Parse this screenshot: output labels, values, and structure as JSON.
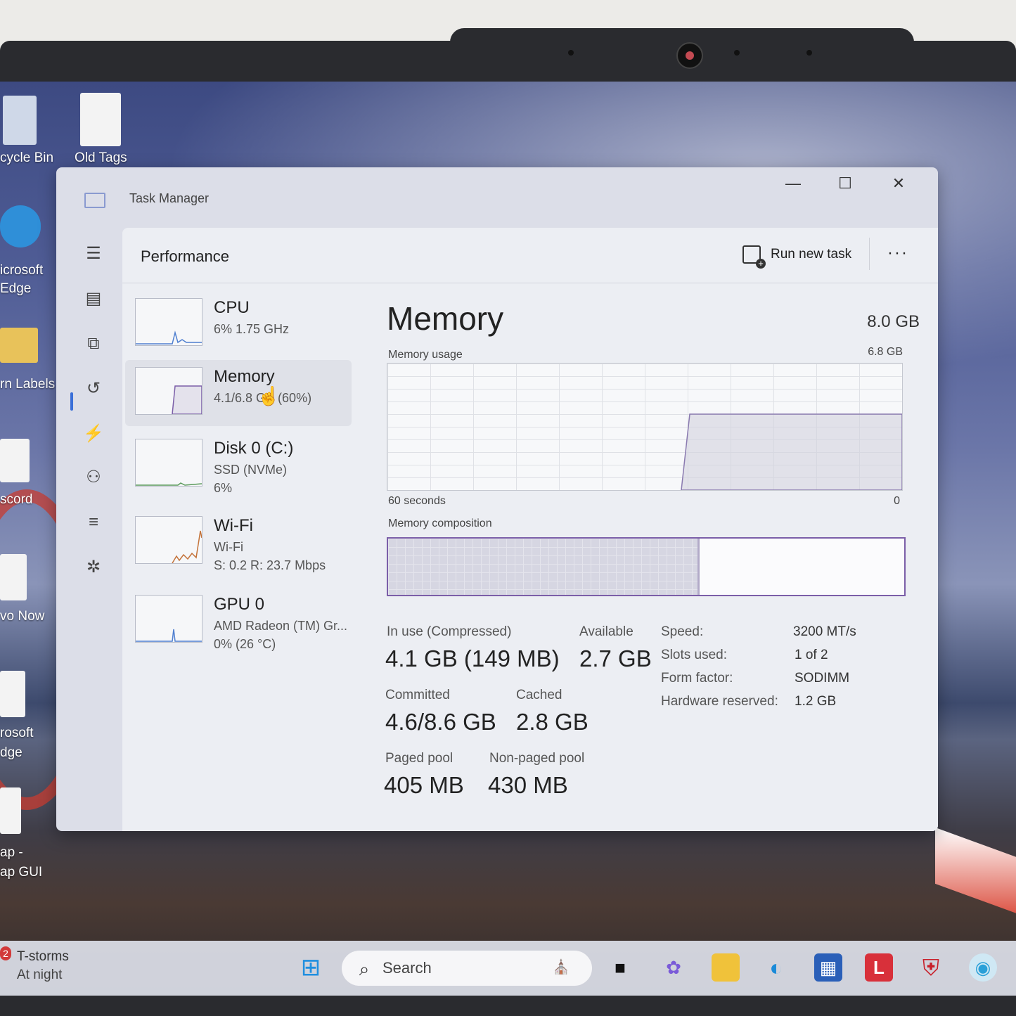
{
  "desktop": {
    "icons": [
      "cycle Bin",
      "Old Tags",
      "icrosoft",
      "Edge",
      "rn Labels",
      "scord",
      "vo Now",
      "rosoft",
      "dge",
      "ap -",
      "ap GUI"
    ]
  },
  "window": {
    "title": "Task Manager",
    "minimize": "—",
    "maximize": "☐",
    "close": "✕"
  },
  "header": {
    "page_title": "Performance",
    "run_task": "Run new task",
    "more": "···"
  },
  "devices": [
    {
      "name": "CPU",
      "sub1": "6%  1.75 GHz",
      "sub2": ""
    },
    {
      "name": "Memory",
      "sub1": "4.1/6.8 GB (60%)",
      "sub2": ""
    },
    {
      "name": "Disk 0 (C:)",
      "sub1": "SSD (NVMe)",
      "sub2": "6%"
    },
    {
      "name": "Wi-Fi",
      "sub1": "Wi-Fi",
      "sub2": "S: 0.2  R: 23.7 Mbps"
    },
    {
      "name": "GPU 0",
      "sub1": "AMD Radeon (TM) Gr...",
      "sub2": "0%  (26 °C)"
    }
  ],
  "memory": {
    "title": "Memory",
    "total": "8.0 GB",
    "usage_label": "Memory usage",
    "usage_max": "6.8 GB",
    "time_left": "60 seconds",
    "time_right": "0",
    "composition_label": "Memory composition",
    "in_use_fraction": 0.6,
    "stats": {
      "in_use_label": "In use (Compressed)",
      "in_use_value": "4.1 GB (149 MB)",
      "available_label": "Available",
      "available_value": "2.7 GB",
      "committed_label": "Committed",
      "committed_value": "4.6/8.6 GB",
      "cached_label": "Cached",
      "cached_value": "2.8 GB",
      "paged_label": "Paged pool",
      "paged_value": "405 MB",
      "nonpaged_label": "Non-paged pool",
      "nonpaged_value": "430 MB"
    },
    "specs": [
      {
        "k": "Speed:",
        "v": "3200 MT/s"
      },
      {
        "k": "Slots used:",
        "v": "1 of 2"
      },
      {
        "k": "Form factor:",
        "v": "SODIMM"
      },
      {
        "k": "Hardware reserved:",
        "v": "1.2 GB"
      }
    ]
  },
  "taskbar": {
    "weather_badge": "2",
    "weather_line1": "T-storms",
    "weather_line2": "At night",
    "search_label": "Search"
  },
  "colors": {
    "accent": "#3a6fd8",
    "memory_border": "#7b5ea8",
    "wifi_line": "#c4733a"
  }
}
